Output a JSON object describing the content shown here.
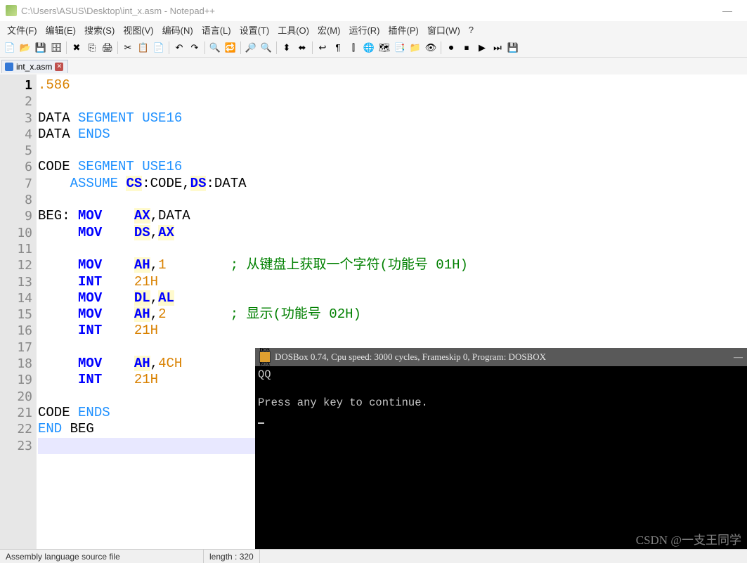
{
  "window": {
    "title": "C:\\Users\\ASUS\\Desktop\\int_x.asm - Notepad++"
  },
  "menu": [
    "文件(F)",
    "编辑(E)",
    "搜索(S)",
    "视图(V)",
    "编码(N)",
    "语言(L)",
    "设置(T)",
    "工具(O)",
    "宏(M)",
    "运行(R)",
    "插件(P)",
    "窗口(W)",
    "?"
  ],
  "tab": {
    "name": "int_x.asm"
  },
  "code": {
    "lines": [
      [
        {
          "t": ".586",
          "c": "dir"
        }
      ],
      [],
      [
        {
          "t": "DATA ",
          "c": "lbl"
        },
        {
          "t": "SEGMENT ",
          "c": "kw"
        },
        {
          "t": "USE16",
          "c": "kw"
        }
      ],
      [
        {
          "t": "DATA ",
          "c": "lbl"
        },
        {
          "t": "ENDS",
          "c": "kw"
        }
      ],
      [],
      [
        {
          "t": "CODE ",
          "c": "lbl"
        },
        {
          "t": "SEGMENT ",
          "c": "kw"
        },
        {
          "t": "USE16",
          "c": "kw"
        }
      ],
      [
        {
          "t": "    ",
          "c": ""
        },
        {
          "t": "ASSUME ",
          "c": "kw"
        },
        {
          "t": "CS",
          "c": "reg"
        },
        {
          "t": ":CODE,",
          "c": "lbl"
        },
        {
          "t": "DS",
          "c": "reg"
        },
        {
          "t": ":DATA",
          "c": "lbl"
        }
      ],
      [],
      [
        {
          "t": "BEG: ",
          "c": "lbl"
        },
        {
          "t": "MOV",
          "c": "kw2"
        },
        {
          "t": "    ",
          "c": ""
        },
        {
          "t": "AX",
          "c": "reg"
        },
        {
          "t": ",DATA",
          "c": "lbl"
        }
      ],
      [
        {
          "t": "     ",
          "c": ""
        },
        {
          "t": "MOV",
          "c": "kw2"
        },
        {
          "t": "    ",
          "c": ""
        },
        {
          "t": "DS",
          "c": "reg"
        },
        {
          "t": ",",
          "c": "lbl"
        },
        {
          "t": "AX",
          "c": "reg"
        }
      ],
      [],
      [
        {
          "t": "     ",
          "c": ""
        },
        {
          "t": "MOV",
          "c": "kw2"
        },
        {
          "t": "    ",
          "c": ""
        },
        {
          "t": "AH",
          "c": "reg"
        },
        {
          "t": ",",
          "c": "lbl"
        },
        {
          "t": "1",
          "c": "num"
        },
        {
          "t": "        ",
          "c": ""
        },
        {
          "t": "; 从键盘上获取一个字符(功能号 01H)",
          "c": "cmt"
        }
      ],
      [
        {
          "t": "     ",
          "c": ""
        },
        {
          "t": "INT",
          "c": "kw2"
        },
        {
          "t": "    ",
          "c": ""
        },
        {
          "t": "21H",
          "c": "num"
        }
      ],
      [
        {
          "t": "     ",
          "c": ""
        },
        {
          "t": "MOV",
          "c": "kw2"
        },
        {
          "t": "    ",
          "c": ""
        },
        {
          "t": "DL",
          "c": "reg"
        },
        {
          "t": ",",
          "c": "lbl"
        },
        {
          "t": "AL",
          "c": "reg"
        }
      ],
      [
        {
          "t": "     ",
          "c": ""
        },
        {
          "t": "MOV",
          "c": "kw2"
        },
        {
          "t": "    ",
          "c": ""
        },
        {
          "t": "AH",
          "c": "reg"
        },
        {
          "t": ",",
          "c": "lbl"
        },
        {
          "t": "2",
          "c": "num"
        },
        {
          "t": "        ",
          "c": ""
        },
        {
          "t": "; 显示(功能号 02H)",
          "c": "cmt"
        }
      ],
      [
        {
          "t": "     ",
          "c": ""
        },
        {
          "t": "INT",
          "c": "kw2"
        },
        {
          "t": "    ",
          "c": ""
        },
        {
          "t": "21H",
          "c": "num"
        }
      ],
      [],
      [
        {
          "t": "     ",
          "c": ""
        },
        {
          "t": "MOV",
          "c": "kw2"
        },
        {
          "t": "    ",
          "c": ""
        },
        {
          "t": "AH",
          "c": "reg"
        },
        {
          "t": ",",
          "c": "lbl"
        },
        {
          "t": "4CH",
          "c": "num"
        }
      ],
      [
        {
          "t": "     ",
          "c": ""
        },
        {
          "t": "INT",
          "c": "kw2"
        },
        {
          "t": "    ",
          "c": ""
        },
        {
          "t": "21H",
          "c": "num"
        }
      ],
      [],
      [
        {
          "t": "CODE ",
          "c": "lbl"
        },
        {
          "t": "ENDS",
          "c": "kw"
        }
      ],
      [
        {
          "t": "END",
          "c": "kw"
        },
        {
          "t": " BEG",
          "c": "lbl"
        }
      ],
      []
    ],
    "current_line": 23
  },
  "status": {
    "lang": "Assembly language source file",
    "length": "length : 320"
  },
  "dosbox": {
    "title": "DOSBox 0.74, Cpu speed:    3000 cycles, Frameskip  0, Program:   DOSBOX",
    "min": "—",
    "out": "QQ\n\nPress any key to continue."
  },
  "watermark": "CSDN @一支王同学"
}
